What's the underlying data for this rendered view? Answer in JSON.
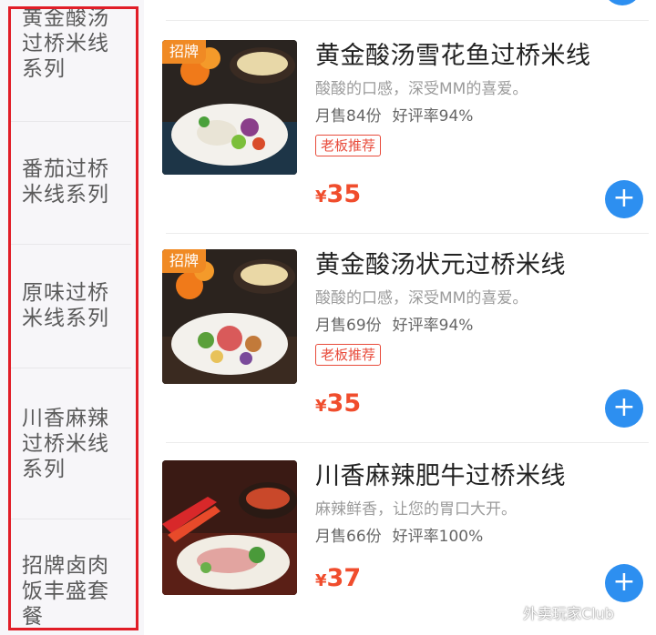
{
  "sidebar": {
    "categories": [
      {
        "lines": [
          "黄金酸汤",
          "过桥米线",
          "系列"
        ]
      },
      {
        "lines": [
          "番茄过桥",
          "米线系列"
        ]
      },
      {
        "lines": [
          "原味过桥",
          "米线系列"
        ]
      },
      {
        "lines": [
          "川香麻辣",
          "过桥米线",
          "系列"
        ]
      },
      {
        "lines": [
          "招牌卤肉",
          "饭丰盛套",
          "餐"
        ]
      }
    ]
  },
  "products": [
    {
      "badge_corner": "招牌",
      "name": "黄金酸汤雪花鱼过桥米线",
      "description": "酸酸的口感，深受MM的喜爱。",
      "sales": "月售84份",
      "rating": "好评率94%",
      "tag": "老板推荐",
      "price_symbol": "¥",
      "price": "35",
      "add_label": "+"
    },
    {
      "badge_corner": "招牌",
      "name": "黄金酸汤状元过桥米线",
      "description": "酸酸的口感，深受MM的喜爱。",
      "sales": "月售69份",
      "rating": "好评率94%",
      "tag": "老板推荐",
      "price_symbol": "¥",
      "price": "35",
      "add_label": "+"
    },
    {
      "badge_corner": "",
      "name": "川香麻辣肥牛过桥米线",
      "description": "麻辣鲜香，让您的胃口大开。",
      "sales": "月售66份",
      "rating": "好评率100%",
      "tag": "",
      "price_symbol": "¥",
      "price": "37",
      "add_label": "+"
    }
  ],
  "watermark": {
    "text": "外卖玩家Club",
    "icon": "wechat-icon"
  },
  "colors": {
    "highlight_border": "#e11d27",
    "price": "#f04d2d",
    "add_button": "#2d8ff0",
    "badge_orange": "#f08a24",
    "tag_border": "#e84b3b"
  }
}
